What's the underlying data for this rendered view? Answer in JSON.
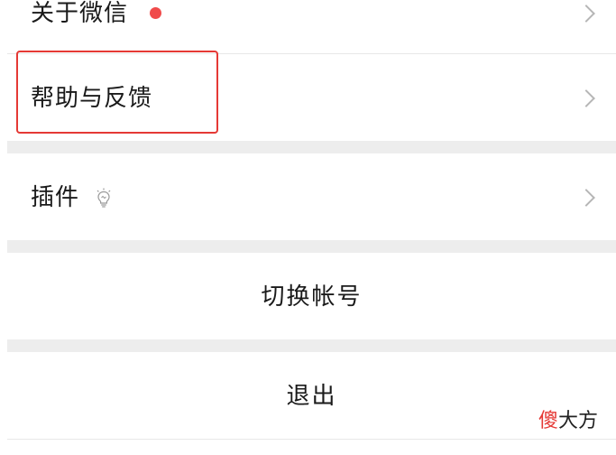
{
  "colors": {
    "background": "#ffffff",
    "section_gap": "#ededed",
    "text": "#1a1a1a",
    "chevron": "#b6b6b6",
    "badge": "#f04b4b",
    "highlight": "#e53935"
  },
  "settings": {
    "items": [
      {
        "label": "关于微信",
        "badge": "red-dot",
        "has_chevron": true
      },
      {
        "label": "帮助与反馈",
        "has_chevron": true,
        "highlighted": true
      },
      {
        "label": "插件",
        "icon": "lightbulb-icon",
        "has_chevron": true
      }
    ],
    "actions": [
      {
        "label": "切换帐号"
      },
      {
        "label": "退出"
      }
    ]
  },
  "watermark": {
    "accent": "傻",
    "rest": "大方"
  }
}
